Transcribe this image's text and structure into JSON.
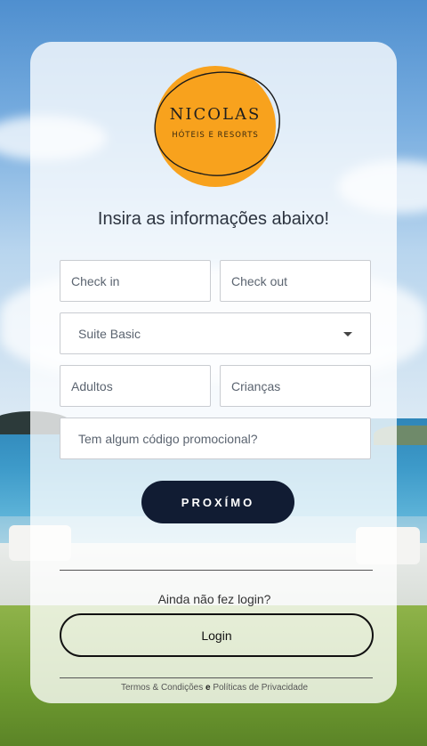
{
  "brand": {
    "name": "NICOLAS",
    "tagline": "HÓTEIS E RESORTS",
    "logo_color": "#f8a21d"
  },
  "form": {
    "heading": "Insira as informações abaixo!",
    "checkin_placeholder": "Check in",
    "checkout_placeholder": "Check out",
    "room_selected": "Suite Basic",
    "adults_placeholder": "Adultos",
    "children_placeholder": "Crianças",
    "promo_placeholder": "Tem algum código promocional?",
    "next_label": "PROXÍMO"
  },
  "login": {
    "prompt": "Ainda não fez login?",
    "button_label": "Login"
  },
  "footer": {
    "terms": "Termos & Condições",
    "and": "e",
    "privacy": "Políticas de Privacidade"
  },
  "colors": {
    "primary_button": "#111c33",
    "card": "rgba(255,255,255,0.78)"
  }
}
